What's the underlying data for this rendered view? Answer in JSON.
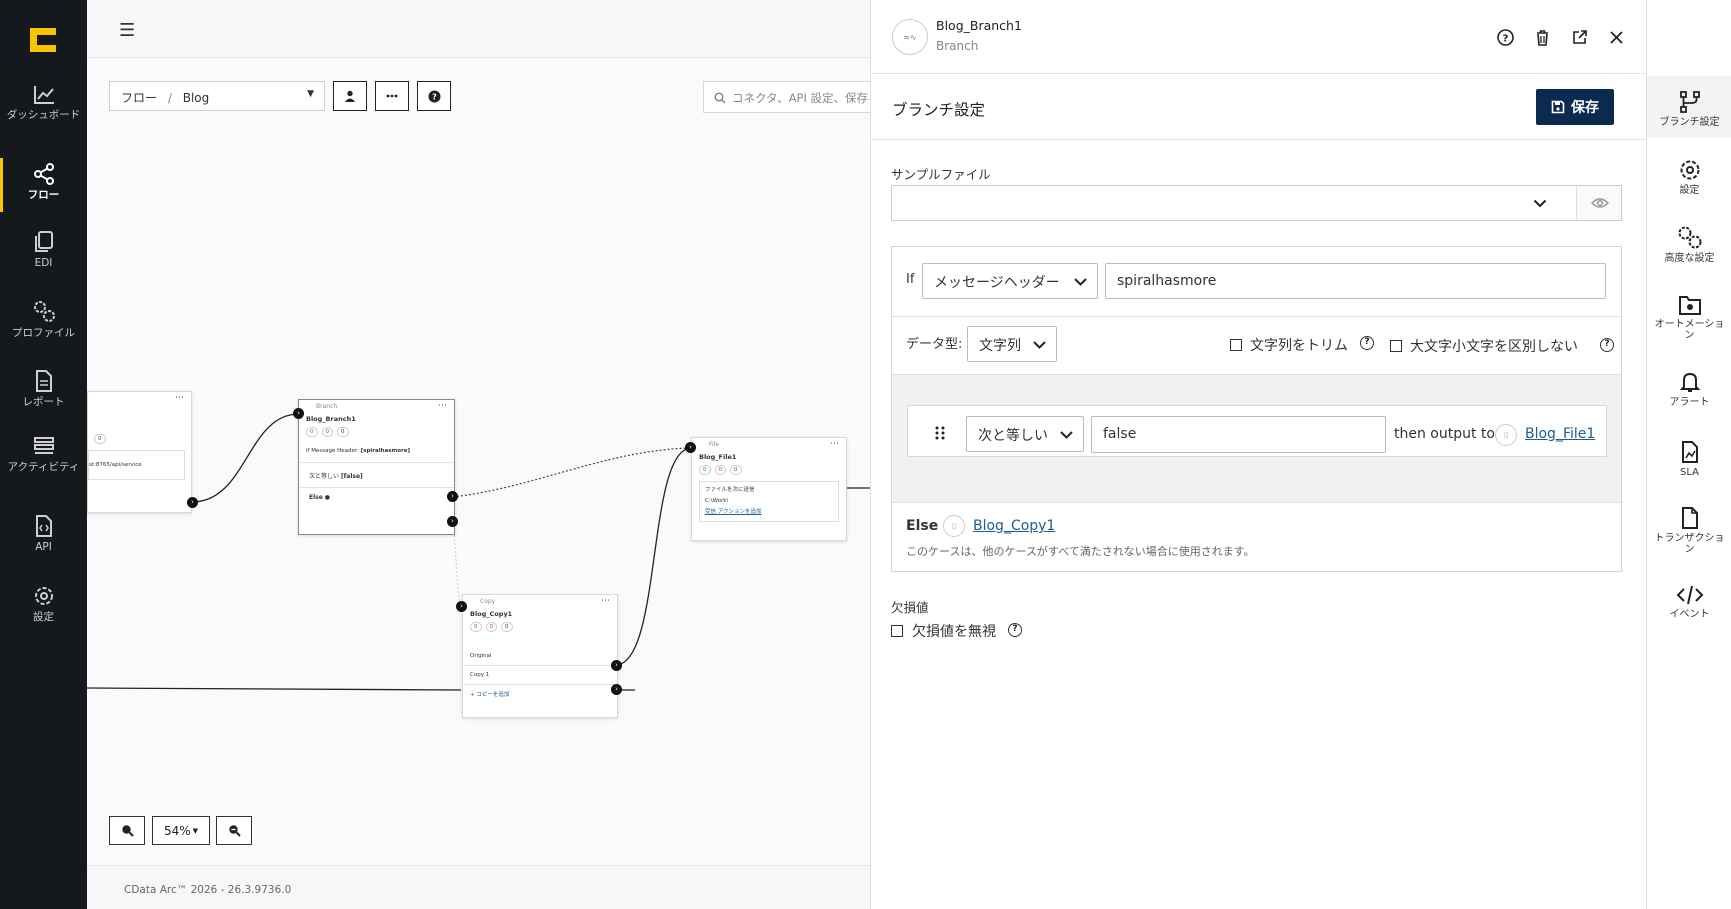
{
  "leftnav": {
    "items": [
      {
        "label": "ダッシュボード",
        "icon": "chart-line-icon"
      },
      {
        "label": "フロー",
        "icon": "share-nodes-icon",
        "active": true
      },
      {
        "label": "EDI",
        "icon": "copy-icon"
      },
      {
        "label": "プロファイル",
        "icon": "gears-icon"
      },
      {
        "label": "レポート",
        "icon": "document-icon"
      },
      {
        "label": "アクティビティ",
        "icon": "layers-icon"
      },
      {
        "label": "API",
        "icon": "code-file-icon"
      },
      {
        "label": "設定",
        "icon": "gear-icon"
      }
    ]
  },
  "canvas": {
    "breadcrumb": {
      "root": "フロー",
      "separator": "/",
      "current": "Blog"
    },
    "search_placeholder": "コネクタ、API 設定、保存",
    "zoom_level": "54%",
    "footer": "CData Arc™ 2026 - 26.3.9736.0",
    "nodes": {
      "left": {
        "chip": "0",
        "url": "st:8765/api/service"
      },
      "branch": {
        "type": "Branch",
        "name": "Blog_Branch1",
        "chips": [
          "0",
          "0",
          "0"
        ],
        "cond_prefix": "If Message Header:",
        "cond_value": "[spiralhasmore]",
        "case_prefix": "次と等しい",
        "case_value": "[false]",
        "else": "Else"
      },
      "file": {
        "type": "File",
        "name": "Blog_File1",
        "chips": [
          "0",
          "0",
          "0"
        ],
        "line1": "ファイルを次に送信",
        "line2": "C:\\Work\\",
        "line3": "受信 アクションを追加"
      },
      "copy": {
        "type": "Copy",
        "name": "Blog_Copy1",
        "chips": [
          "0",
          "0",
          "0"
        ],
        "row1": "Original",
        "row2": "Copy 1",
        "add": "コピーを追加"
      }
    }
  },
  "panel": {
    "header": {
      "avatar_text": "≈∿",
      "title": "Blog_Branch1",
      "subtitle": "Branch"
    },
    "section_title": "ブランチ設定",
    "save_label": "保存",
    "sample_file_label": "サンプルファイル",
    "if_label": "If",
    "if_source": "メッセージヘッダー",
    "if_value": "spiralhasmore",
    "datatype_label": "データ型:",
    "datatype_value": "文字列",
    "trim_label": "文字列をトリム",
    "case_insensitive_label": "大文字小文字を区別しない",
    "case": {
      "operator": "次と等しい",
      "value": "false",
      "then_text": "then output to",
      "target": "Blog_File1"
    },
    "else": {
      "label": "Else",
      "target": "Blog_Copy1",
      "desc": "このケースは、他のケースがすべて満たされない場合に使用されます。"
    },
    "missing_label": "欠損値",
    "ignore_missing_label": "欠損値を無視"
  },
  "righttabs": [
    {
      "label": "ブランチ設定",
      "icon": "branch-icon",
      "active": true
    },
    {
      "label": "設定",
      "icon": "gear-icon"
    },
    {
      "label": "高度な設定",
      "icon": "gears-icon"
    },
    {
      "label": "オートメーション",
      "icon": "automation-folder-icon"
    },
    {
      "label": "アラート",
      "icon": "bell-icon"
    },
    {
      "label": "SLA",
      "icon": "sla-chart-icon"
    },
    {
      "label": "トランザクション",
      "icon": "transaction-file-icon"
    },
    {
      "label": "イベント",
      "icon": "code-icon"
    }
  ],
  "colors": {
    "nav_bg": "#15191d",
    "accent": "#f6c400",
    "save_bg": "#0b2a4f",
    "link": "#1f5d8c"
  }
}
